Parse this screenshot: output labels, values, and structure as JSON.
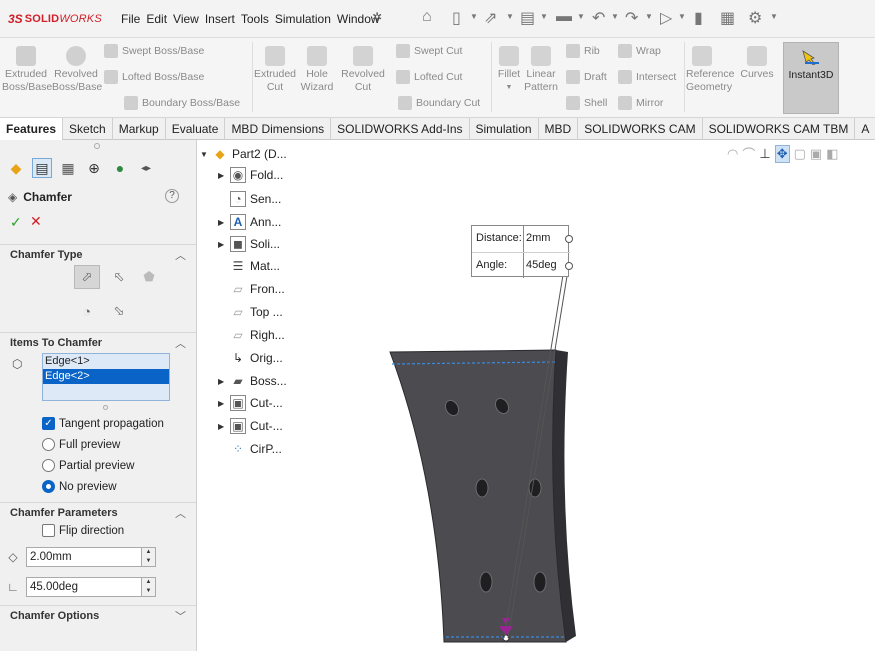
{
  "app": {
    "logo_prefix": "3S",
    "logo_text_bold": "SOLID",
    "logo_text_italic": "WORKS",
    "menu": [
      "File",
      "Edit",
      "View",
      "Insert",
      "Tools",
      "Simulation",
      "Window"
    ]
  },
  "ribbon": {
    "extruded_boss": "Extruded\nBoss/Base",
    "revolved_boss": "Revolved\nBoss/Base",
    "swept_boss": "Swept Boss/Base",
    "lofted_boss": "Lofted Boss/Base",
    "boundary_boss": "Boundary Boss/Base",
    "extruded_cut": "Extruded\nCut",
    "hole_wizard": "Hole\nWizard",
    "revolved_cut": "Revolved\nCut",
    "swept_cut": "Swept Cut",
    "lofted_cut": "Lofted Cut",
    "boundary_cut": "Boundary Cut",
    "fillet": "Fillet",
    "linear_pattern": "Linear\nPattern",
    "rib": "Rib",
    "draft": "Draft",
    "shell": "Shell",
    "wrap": "Wrap",
    "intersect": "Intersect",
    "mirror": "Mirror",
    "reference_geometry": "Reference\nGeometry",
    "curves": "Curves",
    "instant3d": "Instant3D"
  },
  "tabs": [
    "Features",
    "Sketch",
    "Markup",
    "Evaluate",
    "MBD Dimensions",
    "SOLIDWORKS Add-Ins",
    "Simulation",
    "MBD",
    "SOLIDWORKS CAM",
    "SOLIDWORKS CAM TBM",
    "A"
  ],
  "property_manager": {
    "title": "Chamfer",
    "help": "?",
    "ok": "✓",
    "cancel": "✕",
    "chamfer_type_header": "Chamfer Type",
    "items_header": "Items To Chamfer",
    "items": [
      "Edge<1>",
      "Edge<2>"
    ],
    "tangent_propagation": "Tangent propagation",
    "full_preview": "Full preview",
    "partial_preview": "Partial preview",
    "no_preview": "No preview",
    "params_header": "Chamfer Parameters",
    "flip_direction": "Flip direction",
    "distance_value": "2.00mm",
    "angle_value": "45.00deg",
    "options_header": "Chamfer Options"
  },
  "tree": {
    "part": "Part2 (D...",
    "nodes": [
      "Fold...",
      "Sen...",
      "Ann...",
      "Soli...",
      "Mat...",
      "Fron...",
      "Top ...",
      "Righ...",
      "Orig...",
      "Boss...",
      "Cut-...",
      "Cut-...",
      "CirP..."
    ]
  },
  "callout": {
    "distance_label": "Distance:",
    "distance_value": "2mm",
    "angle_label": "Angle:",
    "angle_value": "45deg"
  },
  "colors": {
    "selection_blue": "#0a64c8",
    "part_gray": "#4b4b50",
    "edge_highlight": "#3a8be0",
    "arrow_magenta": "#a0209a"
  }
}
